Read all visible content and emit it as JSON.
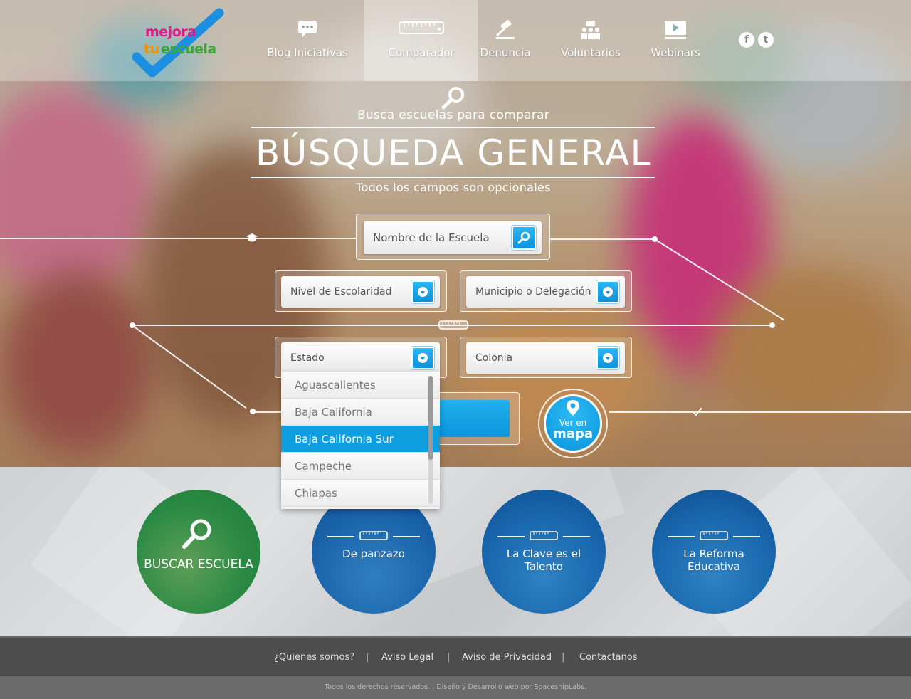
{
  "logo": {
    "line1": "mejora",
    "line2a": "tu",
    "line2b": "escuela"
  },
  "nav": [
    {
      "label": "Blog Iniciativas",
      "icon": "chat-bubble-icon"
    },
    {
      "label": "Comparador",
      "icon": "ruler-icon"
    },
    {
      "label": "Denuncia",
      "icon": "gavel-icon"
    },
    {
      "label": "Voluntarios",
      "icon": "people-icon"
    },
    {
      "label": "Webinars",
      "icon": "video-icon"
    }
  ],
  "social": {
    "facebook": "f",
    "twitter": "t"
  },
  "hero": {
    "subtitle": "Busca escuelas para comparar",
    "title": "BÚSQUEDA GENERAL",
    "note": "Todos los campos son opcionales"
  },
  "form": {
    "school_name_placeholder": "Nombre de la Escuela",
    "nivel": "Nivel de Escolaridad",
    "municipio": "Municipio o Delegación",
    "estado": "Estado",
    "colonia": "Colonia"
  },
  "estado_options": [
    "Aguascalientes",
    "Baja California",
    "Baja California Sur",
    "Campeche",
    "Chiapas"
  ],
  "estado_selected": "Baja California Sur",
  "map_button": {
    "small": "Ver en",
    "big": "mapa"
  },
  "cards": [
    {
      "title": "BUSCAR ESCUELA"
    },
    {
      "title": "De panzazo"
    },
    {
      "title": "La Clave es el Talento"
    },
    {
      "title": "La Reforma Educativa"
    }
  ],
  "footer": {
    "links": [
      "¿Quienes somos?",
      "Aviso Legal",
      "Aviso de Privacidad",
      "Contactanos"
    ],
    "separator": "|",
    "copyright": "Todos los derechos reservados. | Diseño y Desarrollo web por SpaceshipLabs."
  },
  "colors": {
    "accent": "#0e9ddf",
    "logo_pink": "#e6198a",
    "logo_orange": "#f39200",
    "logo_green": "#3aaa35",
    "logo_blue": "#1d8fe0"
  }
}
